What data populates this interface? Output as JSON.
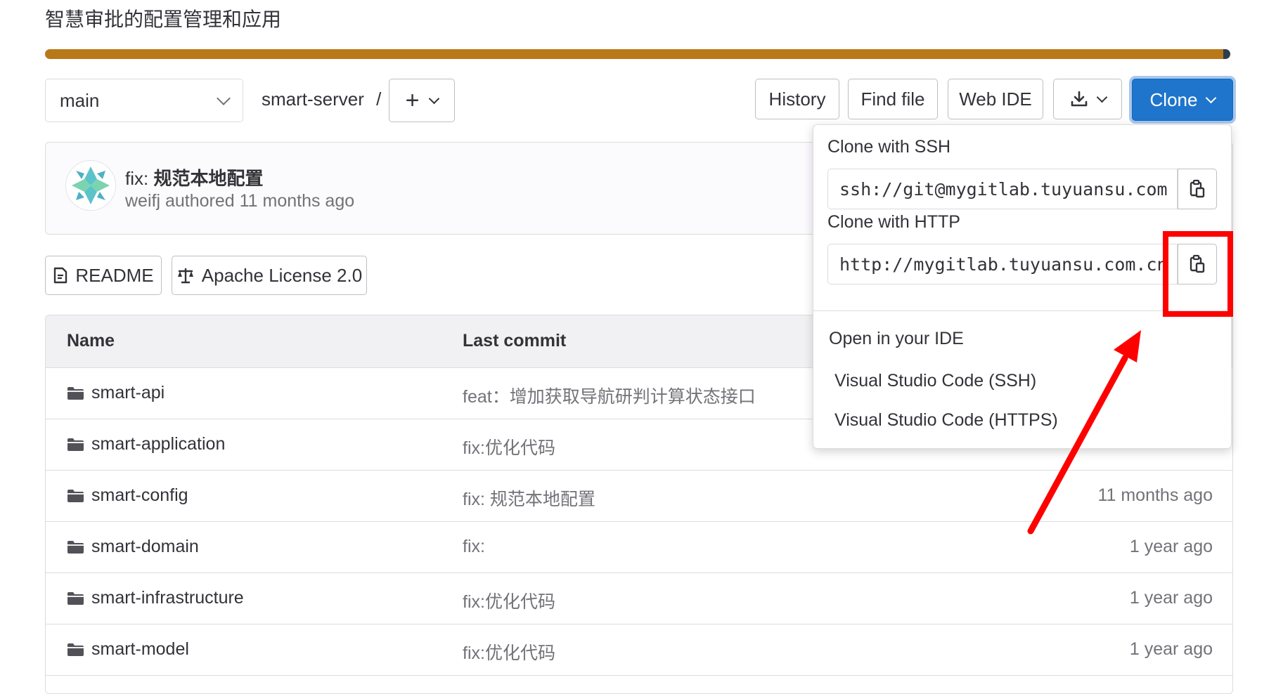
{
  "project": {
    "description": "智慧审批的配置管理和应用",
    "language_bar": {
      "primary_percent": 99.4,
      "primary_color": "#b97918",
      "secondary_color": "#2f3d4c"
    }
  },
  "toolbar": {
    "branch": "main",
    "path": "smart-server",
    "path_separator": "/",
    "history_label": "History",
    "find_file_label": "Find file",
    "web_ide_label": "Web IDE",
    "clone_label": "Clone"
  },
  "last_commit": {
    "prefix": "fix: ",
    "title": "规范本地配置",
    "meta": "weifj authored 11 months ago"
  },
  "badges": {
    "readme": "README",
    "license": "Apache License 2.0"
  },
  "table": {
    "headers": {
      "name": "Name",
      "last_commit": "Last commit"
    },
    "rows": [
      {
        "name": "smart-api",
        "message": "feat：增加获取导航研判计算状态接口",
        "time": ""
      },
      {
        "name": "smart-application",
        "message": "fix:优化代码",
        "time": ""
      },
      {
        "name": "smart-config",
        "message": "fix: 规范本地配置",
        "time": "11 months ago"
      },
      {
        "name": "smart-domain",
        "message": "fix:",
        "time": "1 year ago"
      },
      {
        "name": "smart-infrastructure",
        "message": "fix:优化代码",
        "time": "1 year ago"
      },
      {
        "name": "smart-model",
        "message": "fix:优化代码",
        "time": "1 year ago"
      }
    ]
  },
  "clone_dropdown": {
    "ssh_label": "Clone with SSH",
    "ssh_url": "ssh://git@mygitlab.tuyuansu.com",
    "http_label": "Clone with HTTP",
    "http_url": "http://mygitlab.tuyuansu.com.cn",
    "ide_label": "Open in your IDE",
    "ide_options": [
      "Visual Studio Code (SSH)",
      "Visual Studio Code (HTTPS)"
    ]
  },
  "annotation": {
    "color": "#ff0000"
  }
}
